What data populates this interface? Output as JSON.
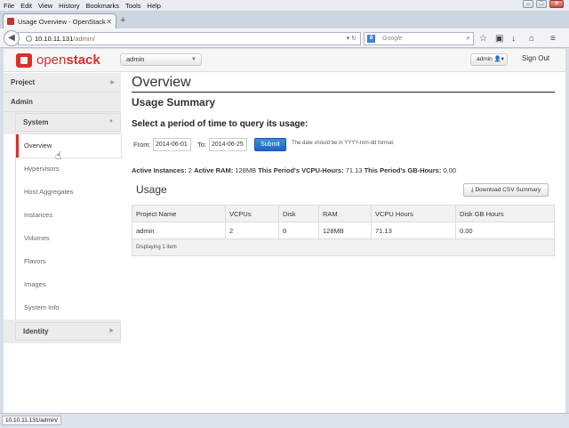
{
  "browser": {
    "menu": [
      "File",
      "Edit",
      "View",
      "History",
      "Bookmarks",
      "Tools",
      "Help"
    ],
    "tab_title": "Usage Overview - OpenStack ...",
    "url_host": "10.10.11.131",
    "url_path": "/admin/",
    "search_engine": "Google",
    "status_url": "10.10.11.131/admin/"
  },
  "brand": {
    "open": "open",
    "stack": "stack",
    "color": "#d6322a"
  },
  "topbar": {
    "project": "admin",
    "user": "admin",
    "signout": "Sign Out"
  },
  "sidebar": {
    "project": "Project",
    "admin": "Admin",
    "system": "System",
    "items": [
      "Overview",
      "Hypervisors",
      "Host Aggregates",
      "Instances",
      "Volumes",
      "Flavors",
      "Images",
      "System Info"
    ],
    "identity": "Identity"
  },
  "main": {
    "title": "Overview",
    "subtitle": "Usage Summary",
    "period_heading": "Select a period of time to query its usage:",
    "from_label": "From:",
    "from_value": "2014-06-01",
    "to_label": "To:",
    "to_value": "2014-06-25",
    "submit": "Submit",
    "hint": "The date should be in YYYY-mm-dd format.",
    "stats": [
      {
        "label": "Active Instances:",
        "value": "2"
      },
      {
        "label": "Active RAM:",
        "value": "128MB"
      },
      {
        "label": "This Period's VCPU-Hours:",
        "value": "71.13"
      },
      {
        "label": "This Period's GB-Hours:",
        "value": "0.00"
      }
    ],
    "usage_title": "Usage",
    "csv_button": "Download CSV Summary"
  },
  "table": {
    "headers": [
      "Project Name",
      "VCPUs",
      "Disk",
      "RAM",
      "VCPU Hours",
      "Disk GB Hours"
    ],
    "rows": [
      [
        "admin",
        "2",
        "0",
        "128MB",
        "71.13",
        "0.00"
      ]
    ],
    "footer": "Displaying 1 item"
  }
}
